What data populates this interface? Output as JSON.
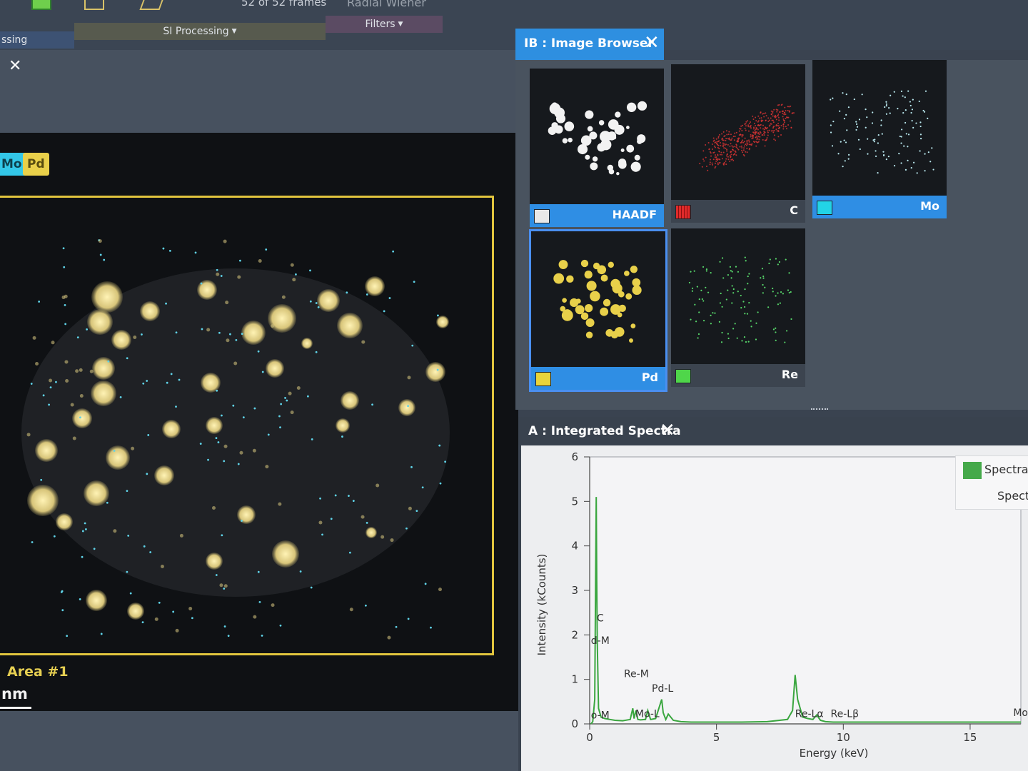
{
  "toolbar": {
    "frames": "52 of 52 frames",
    "radial": "Radial Wiener",
    "processing_tab": "ssing",
    "si_processing_tab": "SI Processing",
    "filters_tab": "Filters"
  },
  "map": {
    "chip_mo": "Mo",
    "chip_pd": "Pd",
    "area_label": "Area #1",
    "scale_label": "nm"
  },
  "image_browser": {
    "title": "IB : Image Browser",
    "thumbnails": [
      {
        "label": "HAADF",
        "color": "#e8e8e8"
      },
      {
        "label": "C",
        "color": "#e02a2a"
      },
      {
        "label": "Mo",
        "color": "#22d3e6"
      },
      {
        "label": "Pd",
        "color": "#e8d43a"
      },
      {
        "label": "Re",
        "color": "#4fd64a"
      }
    ]
  },
  "spectra": {
    "title": "A : Integrated Spectra",
    "legend_primary": "Spectra",
    "legend_secondary": "Spectr"
  },
  "chart_data": {
    "type": "line",
    "xlabel": "Energy (keV)",
    "ylabel": "Intensity (kCounts)",
    "xlim": [
      0,
      17
    ],
    "ylim": [
      0,
      6
    ],
    "x_ticks": [
      "0",
      "5",
      "10",
      "15"
    ],
    "y_ticks": [
      "0",
      "1",
      "2",
      "3",
      "4",
      "5",
      "6"
    ],
    "series": [
      {
        "name": "Spectra",
        "color": "#3aa63f",
        "x": [
          0.05,
          0.12,
          0.2,
          0.26,
          0.28,
          0.3,
          0.35,
          0.45,
          0.6,
          0.8,
          1.0,
          1.3,
          1.6,
          1.7,
          1.75,
          1.82,
          1.9,
          2.0,
          2.2,
          2.29,
          2.4,
          2.6,
          2.84,
          2.9,
          3.0,
          3.1,
          3.3,
          3.6,
          4.0,
          5.0,
          6.0,
          7.0,
          7.8,
          8.0,
          8.1,
          8.2,
          8.4,
          8.6,
          8.8,
          8.95,
          9.1,
          9.3,
          9.6,
          10.0,
          11.0,
          12.0,
          13.0,
          14.0,
          15.0,
          16.0,
          17.0
        ],
        "y": [
          0.0,
          0.05,
          0.55,
          5.1,
          3.2,
          1.8,
          0.35,
          0.15,
          0.12,
          0.1,
          0.08,
          0.07,
          0.1,
          0.35,
          0.12,
          0.3,
          0.1,
          0.09,
          0.1,
          0.3,
          0.1,
          0.12,
          0.55,
          0.25,
          0.1,
          0.22,
          0.08,
          0.05,
          0.04,
          0.04,
          0.04,
          0.05,
          0.1,
          0.3,
          1.1,
          0.55,
          0.15,
          0.12,
          0.1,
          0.2,
          0.08,
          0.05,
          0.04,
          0.04,
          0.04,
          0.04,
          0.04,
          0.04,
          0.04,
          0.04,
          0.04
        ]
      }
    ],
    "annotations": [
      {
        "text": "C",
        "x": 0.28,
        "y": 2.3
      },
      {
        "text": "d-M",
        "x": 0.05,
        "y": 1.8
      },
      {
        "text": "Re-M",
        "x": 1.35,
        "y": 1.05
      },
      {
        "text": "Pd-L",
        "x": 2.45,
        "y": 0.72
      },
      {
        "text": "o-M",
        "x": 0.05,
        "y": 0.12
      },
      {
        "text": "Mo-L",
        "x": 1.8,
        "y": 0.15
      },
      {
        "text": "Re-Lα",
        "x": 8.1,
        "y": 0.15
      },
      {
        "text": "Re-Lβ",
        "x": 9.5,
        "y": 0.15
      },
      {
        "text": "Mo",
        "x": 16.7,
        "y": 0.18
      }
    ]
  }
}
